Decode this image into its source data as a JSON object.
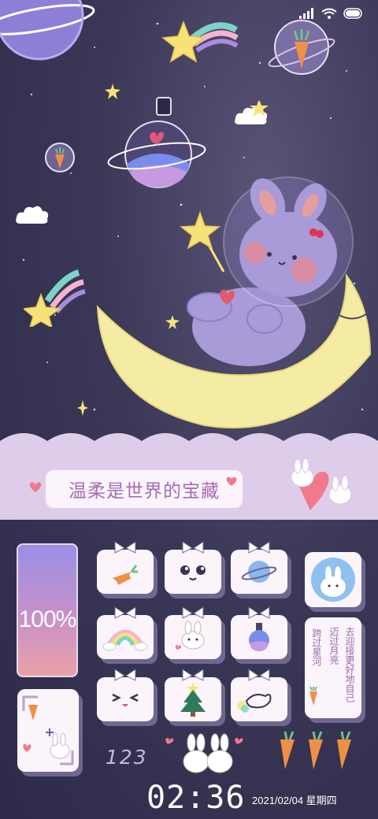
{
  "banner": {
    "slogan": "温柔是世界的宝藏"
  },
  "battery": {
    "percent": 100,
    "label": "100%"
  },
  "memo": {
    "line1": "跨过星河",
    "line2": "迈过月亮",
    "line3": "去迎接更好地自己"
  },
  "counter": "123",
  "clock": {
    "time": "02:36",
    "date": "2021/02/04 星期四"
  },
  "status_icons": [
    "signal-icon",
    "wifi-icon",
    "battery-icon"
  ],
  "app_icons": [
    "carrot-icon",
    "bunny-face-icon",
    "planet-icon",
    "rainbow-icon",
    "bunny-icon",
    "potion-icon",
    "laughing-face-icon",
    "christmas-tree-icon",
    "bird-icon"
  ],
  "colors": {
    "background": "#3a3658",
    "tile": "#fbf4fb",
    "tile_shadow": "#6f6790",
    "banner": "#ddcdea",
    "moon": "#f5eca4",
    "bunny": "#a99ad8",
    "accent_pink": "#f07a8c"
  }
}
